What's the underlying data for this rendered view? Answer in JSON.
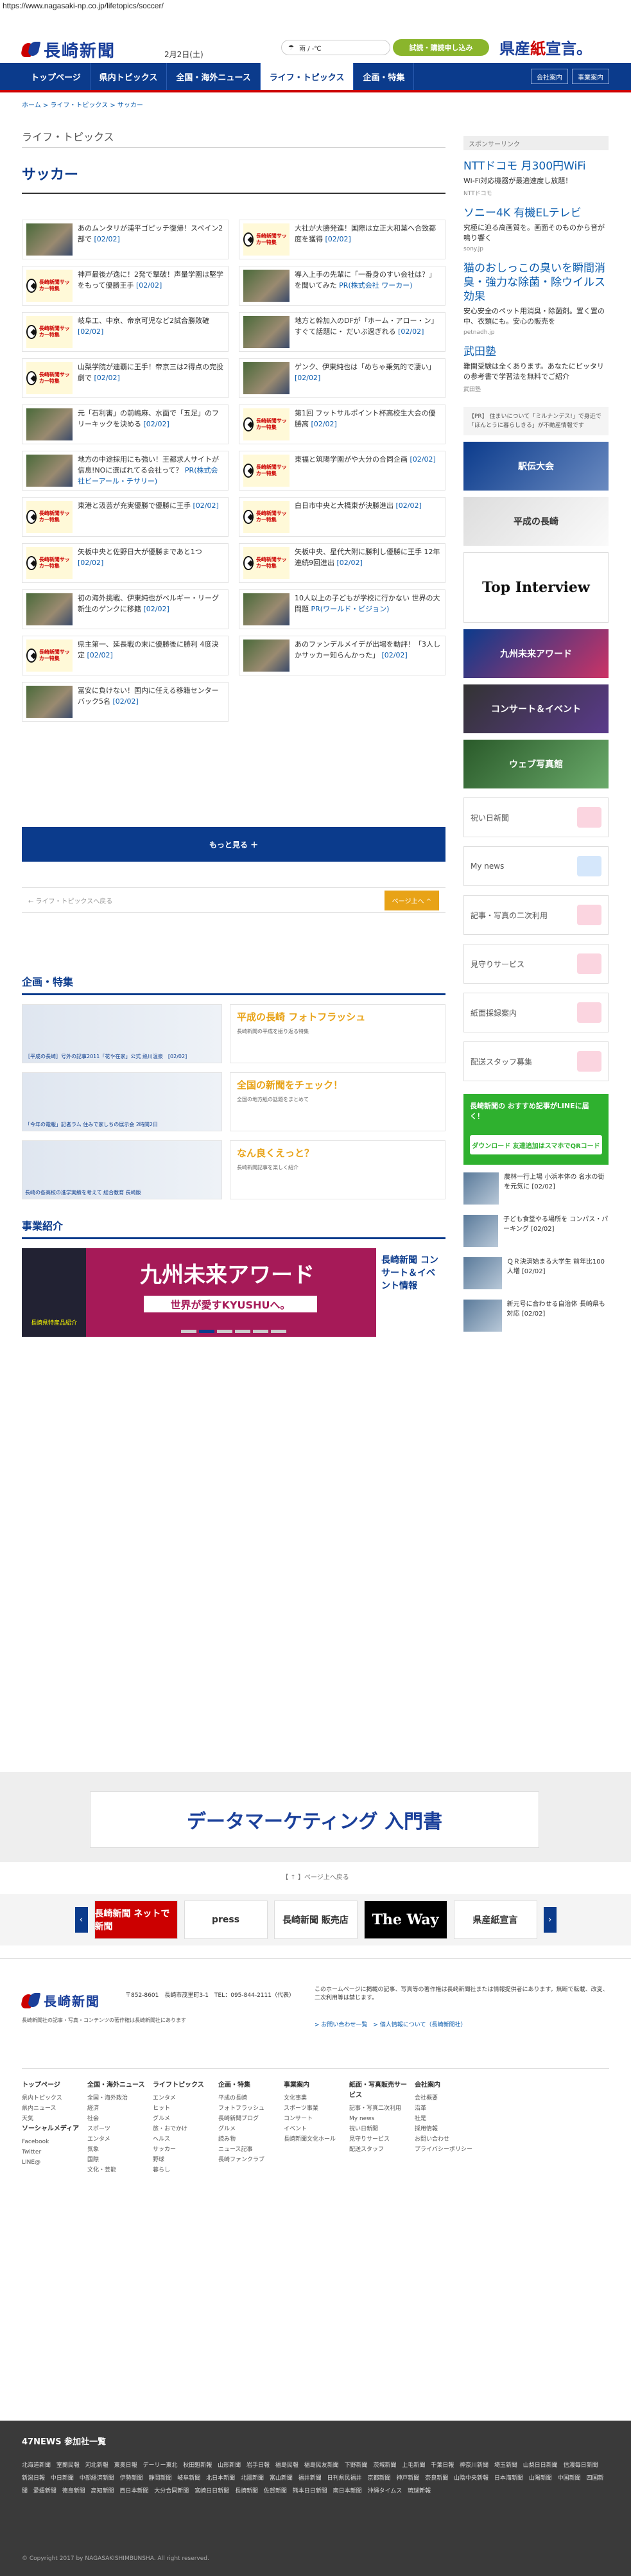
{
  "browser": {
    "url": "https://www.nagasaki-np.co.jp/lifetopics/soccer/"
  },
  "header": {
    "logo_text": "長崎新聞",
    "date": "2月2日(土)",
    "weather_label": "雨 / -℃",
    "trial_button": "試読・購読申し込み",
    "slogan_a": "県産",
    "slogan_b": "紙",
    "slogan_c": "宣言。"
  },
  "nav": {
    "items": [
      "トップページ",
      "県内トピックス",
      "全国・海外ニュース",
      "ライフ・トピックス",
      "企画・特集"
    ],
    "right": [
      "会社案内",
      "事業案内"
    ]
  },
  "breadcrumb": "ホーム > ライフ・トピックス > サッカー",
  "main": {
    "section": "ライフ・トピックス",
    "title": "サッカー",
    "thumb_label": "長崎新聞サッカー特集",
    "articles": [
      {
        "text": "あのムンタリが浦平ゴピッチ復帰！スペイン2部で",
        "date": "[02/02]",
        "img": "photo"
      },
      {
        "text": "大社が大勝発進！国際は立正大和葉へ合致都度を獲得",
        "date": "[02/02]",
        "img": "logo"
      },
      {
        "text": "神戸最後が逸に！2発で撃破！声量学園は堅学をもって優勝王手",
        "date": "[02/02]",
        "img": "logo"
      },
      {
        "text": "導入上手の先輩に「一番身のすい会社は？」を聞いてみた",
        "date": "PR(株式会社 ワーカー)",
        "img": "photo"
      },
      {
        "text": "岐阜工、中京、帝京可児など2試合勝敗確",
        "date": "[02/02]",
        "img": "logo"
      },
      {
        "text": "地方と幹加入のDFが「ホーム・アロー・ン」すぐて話題に・ だいぶ過ぎれる",
        "date": "[02/02]",
        "img": "photo"
      },
      {
        "text": "山梨学院が連覇に王手！帝京三は2得点の完投劇で",
        "date": "[02/02]",
        "img": "logo"
      },
      {
        "text": "ゲンク、伊東純也は「めちゃ乗気的で凄い」",
        "date": "[02/02]",
        "img": "photo"
      },
      {
        "text": "元「石利害」の前嶋麻、水面で「五足」のフリーキックを決める",
        "date": "[02/02]",
        "img": "photo"
      },
      {
        "text": "第1回 フットサルポイント杯高校生大会の優勝高",
        "date": "[02/02]",
        "img": "logo"
      },
      {
        "text": "地方の中途採用にも強い！王都求人サイトが信息!NOに選ばれてる会社って？",
        "date": "PR(株式会社ビーアール・チサリー)",
        "img": "photo"
      },
      {
        "text": "東福と筑陽学園がや大分の合同企画",
        "date": "[02/02]",
        "img": "logo"
      },
      {
        "text": "東港と汲芸が充実優勝で優勝に王手",
        "date": "[02/02]",
        "img": "logo"
      },
      {
        "text": "白日市中央と大橋東が決勝進出",
        "date": "[02/02]",
        "img": "logo"
      },
      {
        "text": "矢板中央と佐野日大が優勝まであと1つ",
        "date": "[02/02]",
        "img": "logo"
      },
      {
        "text": "矢板中央、星代大附に勝利し優勝に王手 12年連続9回進出",
        "date": "[02/02]",
        "img": "logo"
      },
      {
        "text": "初の海外挑戦、伊東純也がベルギー・リーグ新生のゲンクに移籍",
        "date": "[02/02]",
        "img": "photo"
      },
      {
        "text": "10人以上の子どもが学校に行かない 世界の大問題",
        "date": "PR(ワールド・ビジョン)",
        "img": "photo"
      },
      {
        "text": "県主第一、延長戦の末に優勝後に勝利 4度決定",
        "date": "[02/02]",
        "img": "logo"
      },
      {
        "text": "あのファンデルメイデが出場を動評！「3人しかサッカー知らんかった」",
        "date": "[02/02]",
        "img": "photo"
      },
      {
        "text": "冨安に負けない！国内に任える移籍センターバック5名",
        "date": "[02/02]",
        "img": "photo"
      }
    ],
    "more_button": "もっと見る ＋",
    "back_link": "← ライフ・トピックスへ戻る",
    "top_button": "ページ上へ ^"
  },
  "kikaku": {
    "title": "企画・特集",
    "rows": [
      {
        "caption": "［平成の長崎］号外の記事2011「花や在家」公式 熱川温泉　[02/02]",
        "heading": "平成の長崎\nフォトフラッシュ",
        "desc": "長崎新聞の平成を振り返る特集"
      },
      {
        "caption": "「今年の電報」記者ラム 住みで家しちの展示会 2時間2日",
        "heading": "全国の新聞をチェック！",
        "desc": "全国の地方紙の話題をまとめて"
      },
      {
        "caption": "長崎の各高校の進学実績を考えて 総合教育 長崎版",
        "heading": "なん良くえっと？",
        "desc": "長崎新聞記事を楽しく紹介"
      }
    ]
  },
  "jigyo": {
    "title": "事業紹介",
    "carousel_left": "長崎県特産品紹介",
    "carousel_main": "九州未来アワード",
    "carousel_sub": "世界が愛すKYUSHUへ。",
    "carousel_right": "長崎新聞 コンサート＆イベント情報"
  },
  "sidebar": {
    "sponsor_head": "スポンサーリンク",
    "sponsors": [
      {
        "title": "NTTドコモ 月300円WiFi",
        "desc": "Wi-Fi対応機器が最適速度し放題！",
        "src": "NTTドコモ"
      },
      {
        "title": "ソニー4K 有機ELテレビ",
        "desc": "究極に迫る高画質を。画面そのものから音が鳴り響く",
        "src": "sony.jp"
      },
      {
        "title": "猫のおしっこの臭いを瞬間消臭・強力な除菌・除ウイルス効果",
        "desc": "安心安全のペット用消臭・除菌剤。置く置の中、衣類にも。安心の販売を",
        "src": "petnadh.jp"
      },
      {
        "title": "武田塾",
        "desc": "難関受験は全くあります。あなたにピッタリの参考書で学習法を無料でご紹介",
        "src": "武田塾"
      }
    ],
    "pr_box": "【PR】 住まいについて「ミルナンデス!」で身近で「ほんとうに暮らしきる」が不動産情報です",
    "banners": [
      "駅伝大会",
      "平成の長崎",
      "Top Interview",
      "九州未来アワード",
      "コンサート＆イベント",
      "ウェブ写真館"
    ],
    "services": [
      "祝い日新聞",
      "My news",
      "記事・写真の二次利用",
      "見守りサービス",
      "紙面採録案内",
      "配送スタッフ募集"
    ],
    "line_title": "長崎新聞の おすすめ記事がLINEに届く！",
    "line_button": "ダウンロード 友達追加はスマホでQRコード",
    "side_news": [
      {
        "text": "農林一行上場 小浜本体の 名水の街を元気に [02/02]"
      },
      {
        "text": "子ども食堂やる場所を コンパス・パーキング [02/02]"
      },
      {
        "text": "ＱＲ決済始まる大学生 前年比100人増 [02/02]"
      },
      {
        "text": "新元号に合わせる自治体 長崎県も対応 [02/02]"
      }
    ]
  },
  "bottom_ad": {
    "text": "データマーケティング 入門書"
  },
  "tolist": "【 ↑ 】ページ上へ戻る",
  "logos": [
    "長崎新聞 ネットで新聞",
    "press",
    "長崎新聞 販売店",
    "The Way",
    "県産紙宣言"
  ],
  "footer": {
    "logo": "長崎新聞",
    "address": "〒852-8601　長崎市茂里町3-1　TEL：095-844-2111（代表）",
    "note": "長崎新聞社の記事・写真・コンテンツの著作権は長崎新聞社にあります",
    "notice": "このホームページに掲載の記事、写真等の著作権は長崎新聞社または情報提供者にあります。無断で転載、改変、二次利用等は禁じます。",
    "links": "> お問い合わせ一覧　> 個人情報について（長崎新聞社）",
    "cols": [
      {
        "head": "トップページ",
        "items": [
          "県内トピックス",
          "県内ニュース",
          "天気"
        ]
      },
      {
        "head": "全国・海外ニュース",
        "items": [
          "全国・海外政治",
          "経済",
          "社会",
          "スポーツ",
          "エンタメ",
          "気象",
          "国際",
          "文化・芸能"
        ]
      },
      {
        "head": "ライフトピックス",
        "items": [
          "エンタメ",
          "ヒット",
          "グルメ",
          "旅・おでかけ",
          "ヘルス",
          "サッカー",
          "野球",
          "暮らし"
        ]
      },
      {
        "head": "企画・特集",
        "items": [
          "平成の長崎",
          "フォトフラッシュ",
          "長崎新聞ブログ",
          "グルメ",
          "読み物",
          "ニュース記事",
          "長崎ファンクラブ"
        ]
      },
      {
        "head": "事業案内",
        "items": [
          "文化事業",
          "スポーツ事業",
          "コンサート",
          "イベント",
          "長崎新聞文化ホール"
        ]
      },
      {
        "head": "紙面・写真販売サービス",
        "items": [
          "記事・写真二次利用",
          "My news",
          "祝い日新聞",
          "見守りサービス",
          "配送スタッフ"
        ]
      },
      {
        "head": "会社案内",
        "items": [
          "会社概要",
          "沿革",
          "社是",
          "採用情報",
          "お問い合わせ",
          "プライバシーポリシー"
        ]
      }
    ],
    "social_head": "ソーシャルメディア",
    "social": [
      "Facebook",
      "Twitter",
      "LINE@"
    ]
  },
  "footer47": {
    "title": "47NEWS 参加社一覧",
    "papers": "北海道新聞 室蘭民報 河北新報 東奥日報 デーリー東北 秋田魁新報 山形新聞 岩手日報 福島民報 福島民友新聞 下野新聞 茨城新聞 上毛新聞 千葉日報 神奈川新聞 埼玉新聞 山梨日日新聞 信濃毎日新聞 新潟日報 中日新聞 中部経済新聞 伊勢新聞 静岡新聞 岐阜新聞 北日本新聞 北國新聞 富山新聞 福井新聞 日刊県民福井 京都新聞 神戸新聞 奈良新聞 山陰中央新報 日本海新聞 山陽新聞 中国新聞 四国新聞 愛媛新聞 徳島新聞 高知新聞 西日本新聞 大分合同新聞 宮崎日日新聞 長崎新聞 佐賀新聞 熊本日日新聞 南日本新聞 沖縄タイムス 琉球新報",
    "copyright": "© Copyright 2017 by NAGASAKISHIMBUNSHA. All right reserved."
  }
}
